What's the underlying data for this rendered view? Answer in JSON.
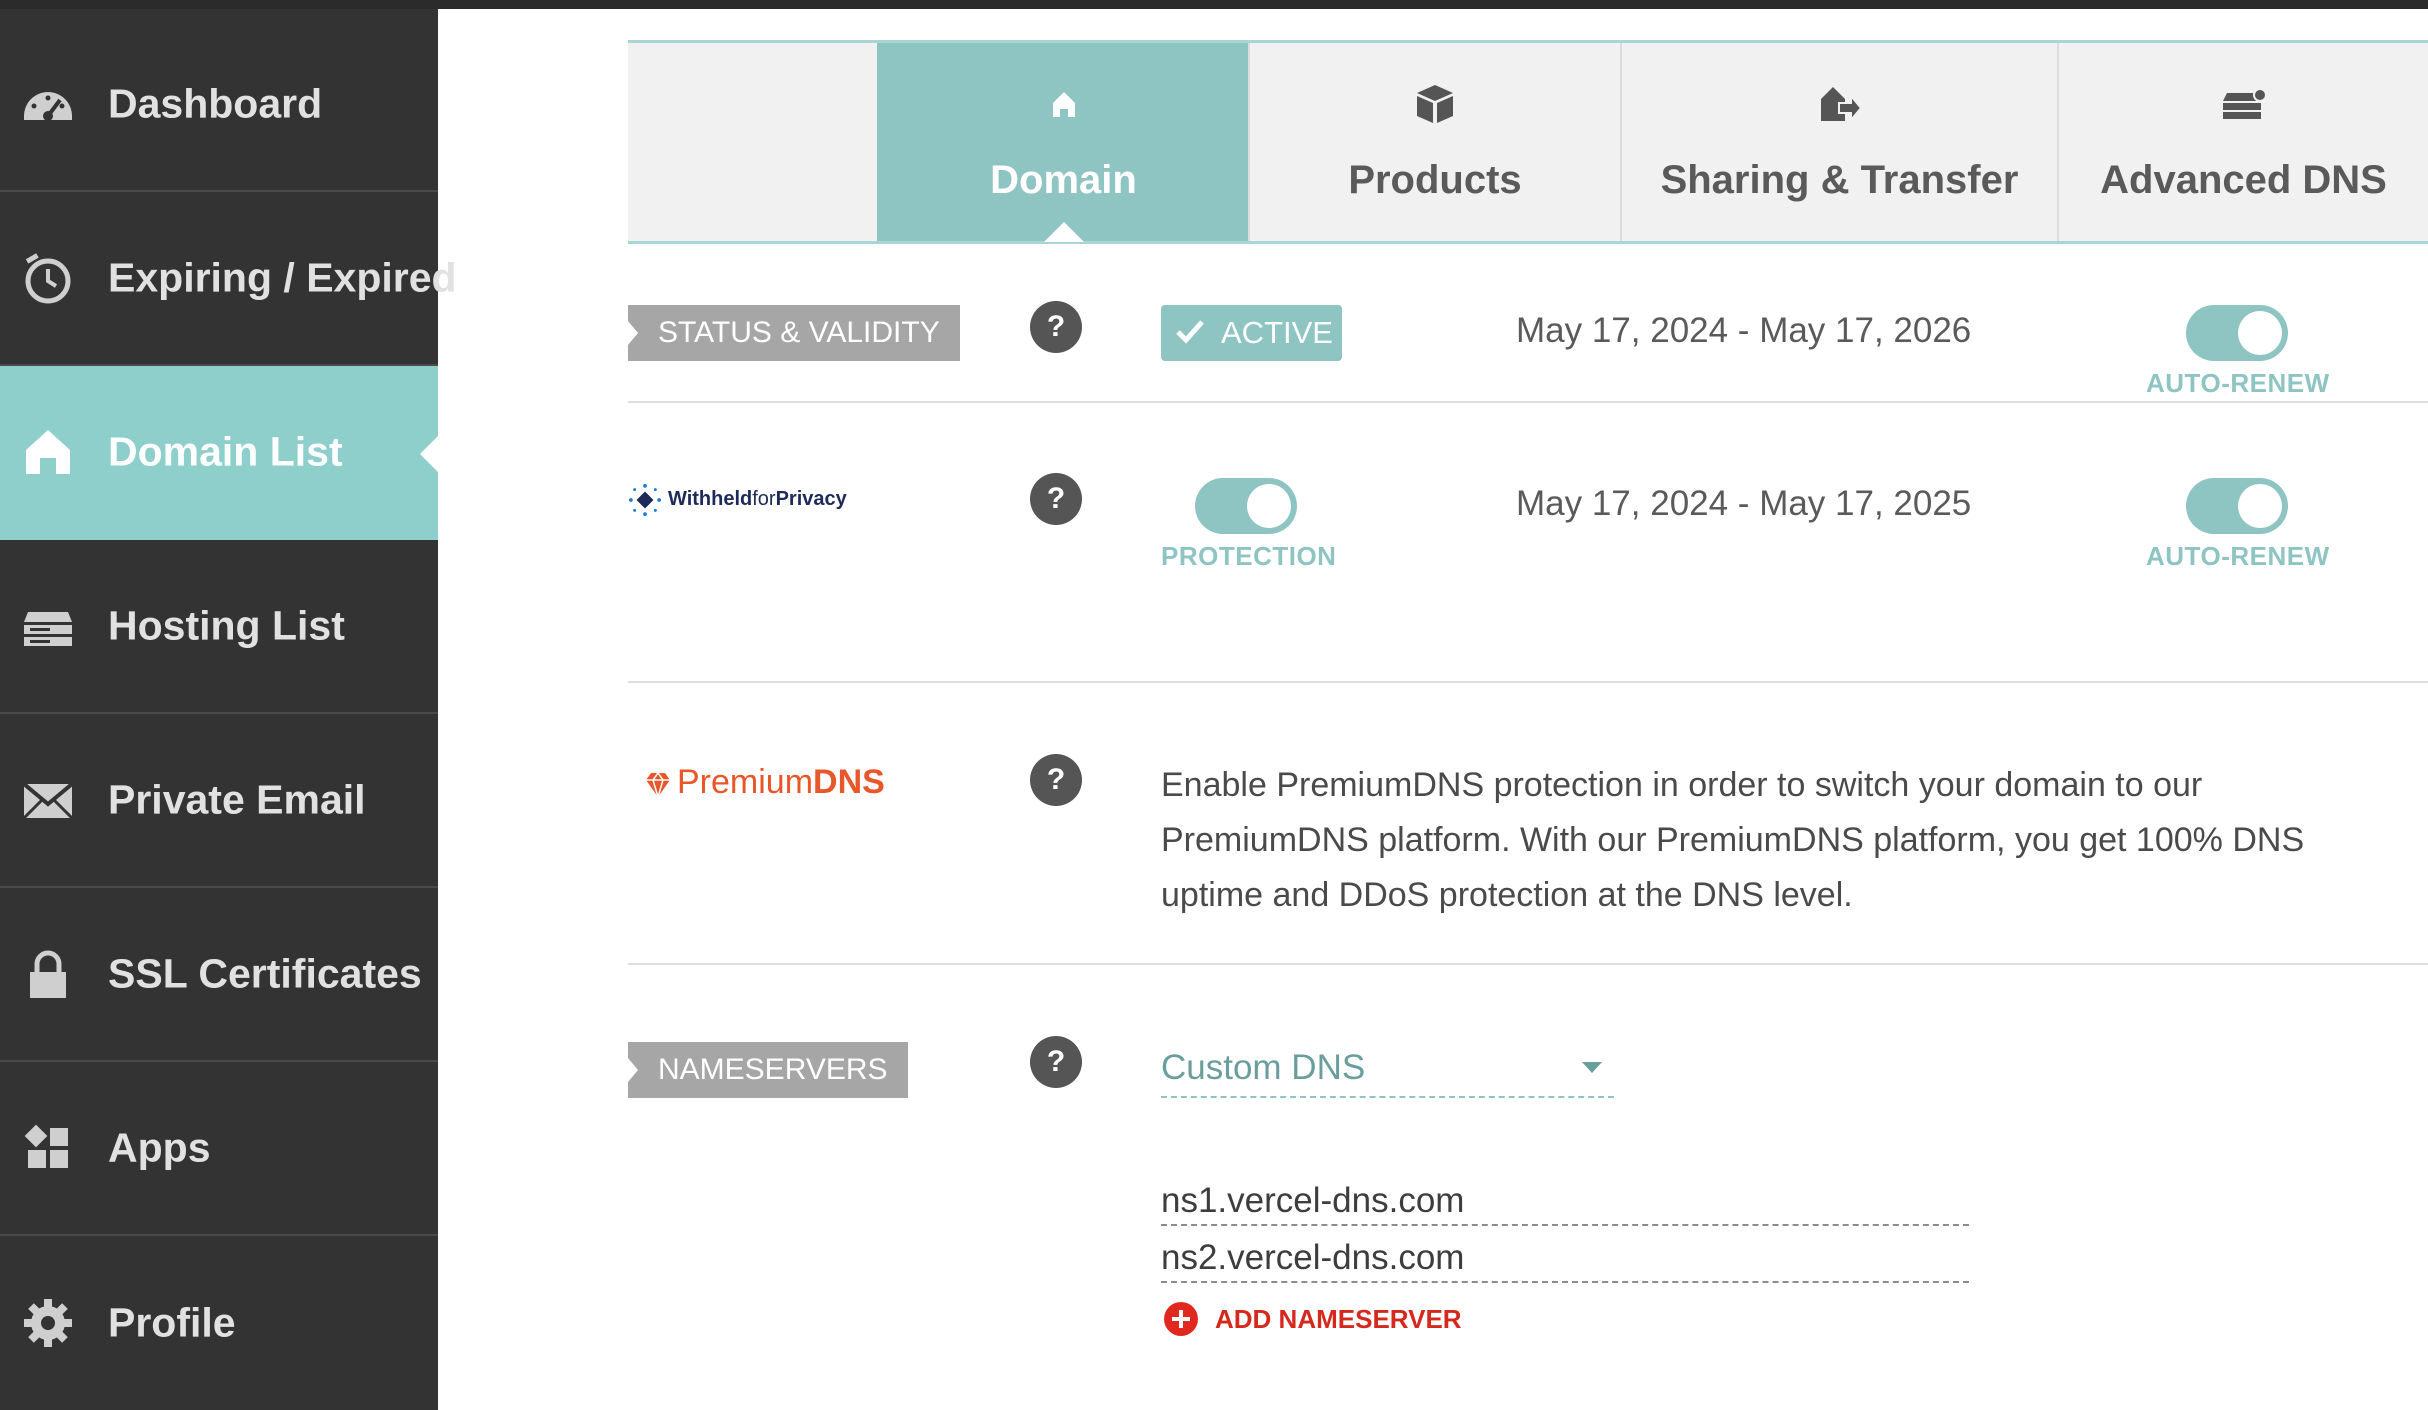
{
  "sidebar": {
    "items": [
      {
        "label": "Dashboard",
        "icon": "speedometer-icon"
      },
      {
        "label": "Expiring / Expired",
        "icon": "timer-icon"
      },
      {
        "label": "Domain List",
        "icon": "home-icon",
        "active": true
      },
      {
        "label": "Hosting List",
        "icon": "server-icon"
      },
      {
        "label": "Private Email",
        "icon": "envelope-icon"
      },
      {
        "label": "SSL Certificates",
        "icon": "lock-icon"
      },
      {
        "label": "Apps",
        "icon": "apps-grid-icon"
      },
      {
        "label": "Profile",
        "icon": "gear-icon"
      }
    ]
  },
  "tabs": [
    {
      "label": "Domain",
      "icon": "home-icon",
      "active": true
    },
    {
      "label": "Products",
      "icon": "box-icon"
    },
    {
      "label": "Sharing & Transfer",
      "icon": "share-transfer-icon"
    },
    {
      "label": "Advanced DNS",
      "icon": "dns-server-icon"
    }
  ],
  "status": {
    "label": "STATUS & VALIDITY",
    "help": "?",
    "badge": "ACTIVE",
    "dates": "May 17, 2024 - May 17, 2026",
    "autorenew_label": "AUTO-RENEW",
    "autorenew_on": true
  },
  "privacy": {
    "logo_text_bold": "Withheld",
    "logo_text_light": "for",
    "logo_text_bold2": "Privacy",
    "help": "?",
    "protection_label": "PROTECTION",
    "protection_on": true,
    "dates": "May 17, 2024 - May 17, 2025",
    "autorenew_label": "AUTO-RENEW",
    "autorenew_on": true
  },
  "premiumdns": {
    "logo_text_light": "Premium",
    "logo_text_bold": "DNS",
    "help": "?",
    "description": "Enable PremiumDNS protection in order to switch your domain to our PremiumDNS platform. With our PremiumDNS platform, you get 100% DNS uptime and DDoS protection at the DNS level."
  },
  "nameservers": {
    "label": "NAMESERVERS",
    "help": "?",
    "selected": "Custom DNS",
    "entries": [
      "ns1.vercel-dns.com",
      "ns2.vercel-dns.com"
    ],
    "add_label": "ADD NAMESERVER"
  },
  "colors": {
    "accent": "#8ec4c2",
    "sidebar_bg": "#333333",
    "sidebar_active": "#8ecfcb",
    "premium_orange": "#e8572a",
    "add_red": "#e0281f"
  }
}
